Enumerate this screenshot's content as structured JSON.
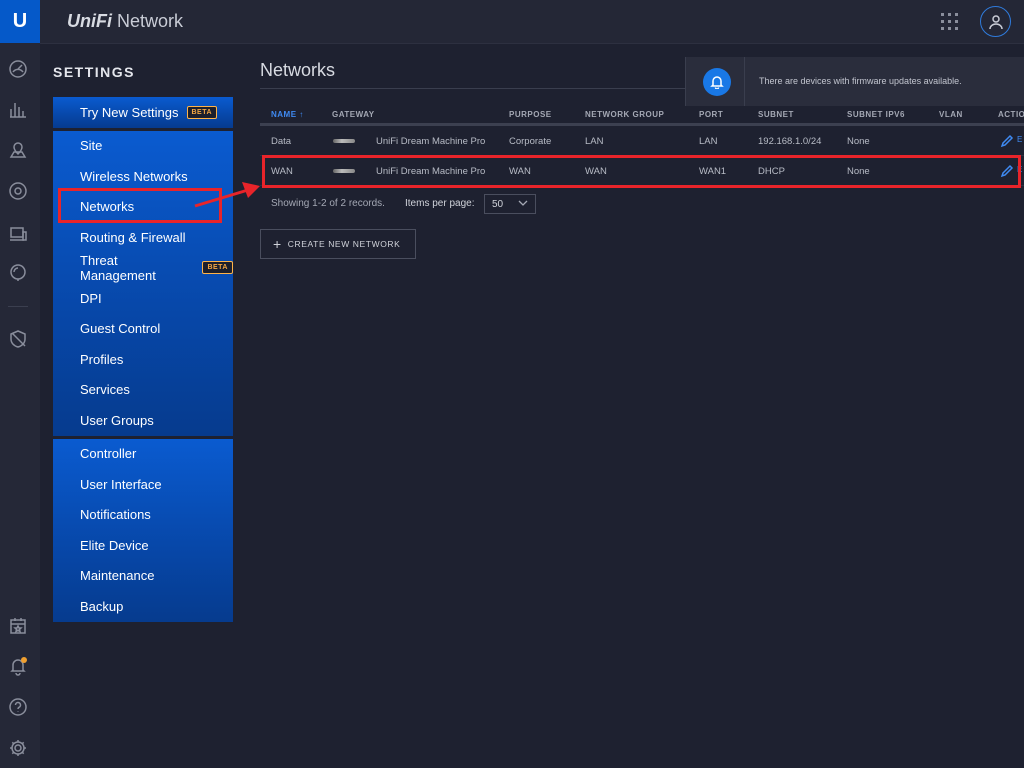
{
  "app": {
    "logo_letter": "U",
    "brand_prefix": "UniFi",
    "brand_name": "Network"
  },
  "settings": {
    "title": "SETTINGS",
    "groups": [
      [
        {
          "label": "Try New Settings",
          "badge": "BETA"
        }
      ],
      [
        {
          "label": "Site"
        },
        {
          "label": "Wireless Networks"
        },
        {
          "label": "Networks"
        },
        {
          "label": "Routing & Firewall"
        },
        {
          "label": "Threat Management",
          "badge": "BETA"
        },
        {
          "label": "DPI"
        },
        {
          "label": "Guest Control"
        },
        {
          "label": "Profiles"
        },
        {
          "label": "Services"
        },
        {
          "label": "User Groups"
        }
      ],
      [
        {
          "label": "Controller"
        },
        {
          "label": "User Interface"
        },
        {
          "label": "Notifications"
        },
        {
          "label": "Elite Device"
        },
        {
          "label": "Maintenance"
        },
        {
          "label": "Backup"
        }
      ]
    ]
  },
  "main": {
    "title": "Networks",
    "columns": [
      "NAME ↑",
      "GATEWAY",
      "PURPOSE",
      "NETWORK GROUP",
      "PORT",
      "SUBNET",
      "SUBNET IPV6",
      "VLAN",
      "ACTIO"
    ],
    "rows": [
      {
        "name": "Data",
        "gateway": "UniFi Dream Machine Pro",
        "purpose": "Corporate",
        "network_group": "LAN",
        "port": "LAN",
        "subnet": "192.168.1.0/24",
        "subnet_ipv6": "None",
        "vlan": "",
        "action": "E"
      },
      {
        "name": "WAN",
        "gateway": "UniFi Dream Machine Pro",
        "purpose": "WAN",
        "network_group": "WAN",
        "port": "WAN1",
        "subnet": "DHCP",
        "subnet_ipv6": "None",
        "vlan": "",
        "action": "E"
      }
    ],
    "records_text": "Showing 1-2 of 2 records.",
    "items_per_page_label": "Items per page:",
    "items_per_page_value": "50",
    "create_button": "CREATE NEW NETWORK"
  },
  "toast": {
    "message": "There are devices with firmware updates available."
  },
  "colors": {
    "accent": "#0559c9",
    "highlight": "#e8242a",
    "badge": "#f5a742",
    "link": "#3f8af2"
  }
}
